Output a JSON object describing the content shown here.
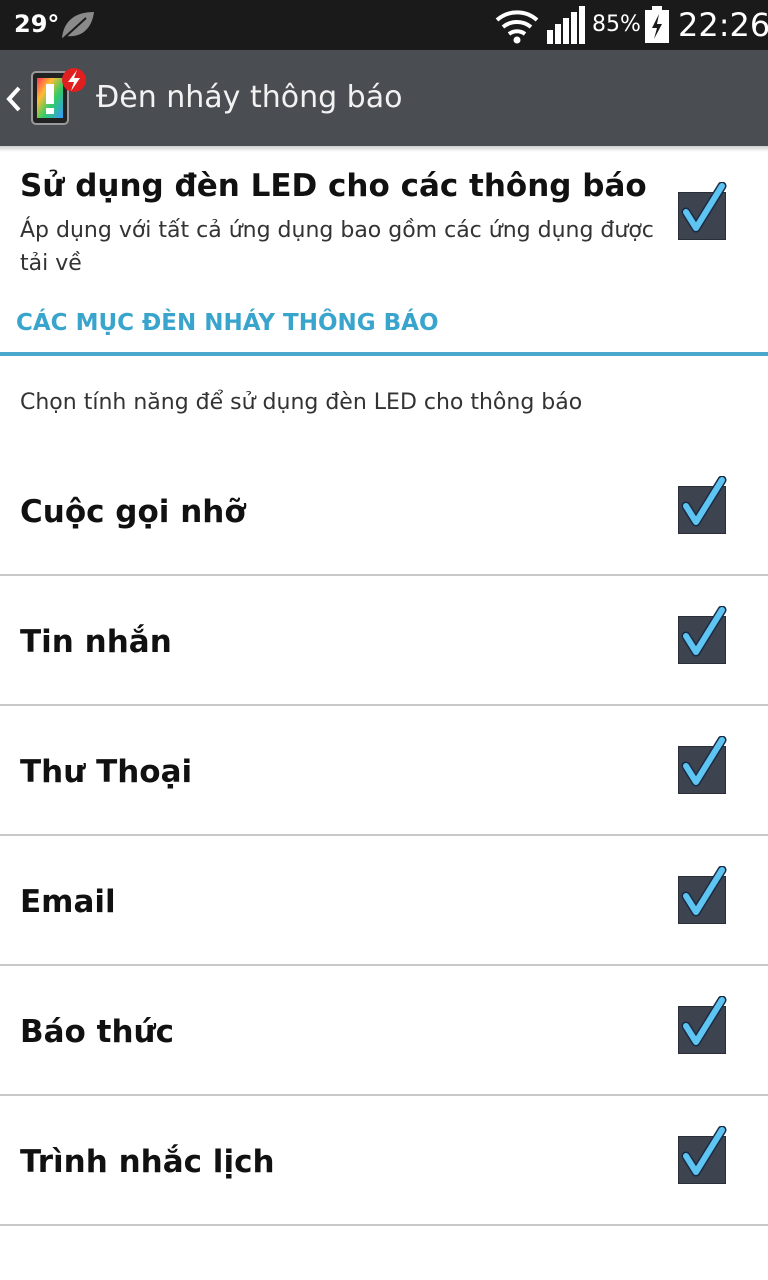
{
  "status_bar": {
    "temperature": "29°",
    "battery_percent": "85%",
    "time": "22:26",
    "icons": [
      "leaf-icon",
      "wifi-icon",
      "signal-icon",
      "battery-charging-icon"
    ]
  },
  "action_bar": {
    "title": "Đèn nháy thông báo",
    "icons": [
      "back-chevron-icon",
      "notification-flash-app-icon"
    ]
  },
  "master_setting": {
    "title": "Sử dụng đèn LED cho các thông báo",
    "summary": "Áp dụng với tất cả ứng dụng bao gồm các ứng dụng được tải về",
    "checked": true
  },
  "category": {
    "header": "CÁC MỤC ĐÈN NHÁY THÔNG BÁO",
    "description": "Chọn tính năng để sử dụng đèn LED cho thông báo",
    "accent_color": "#3aa5cc"
  },
  "items": [
    {
      "label": "Cuộc gọi nhỡ",
      "checked": true
    },
    {
      "label": "Tin nhắn",
      "checked": true
    },
    {
      "label": "Thư Thoại",
      "checked": true
    },
    {
      "label": "Email",
      "checked": true
    },
    {
      "label": "Báo thức",
      "checked": true
    },
    {
      "label": "Trình nhắc lịch",
      "checked": true
    }
  ],
  "colors": {
    "action_bar": "#4a4d52",
    "status_bar": "#1a1a1a",
    "checkmark": "#5ec4f2"
  }
}
